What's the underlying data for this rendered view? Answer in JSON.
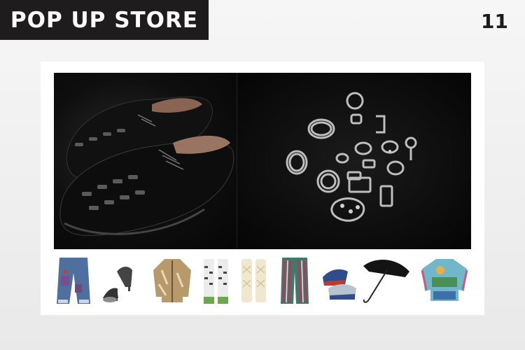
{
  "header": {
    "title": "POP UP STORE",
    "page_number": "11"
  },
  "hero_photos": [
    {
      "name": "black-woven-shoes-photo"
    },
    {
      "name": "silver-jewelry-flatlay-photo"
    }
  ],
  "products": [
    {
      "name": "patched-jeans"
    },
    {
      "name": "strappy-heels"
    },
    {
      "name": "knit-cardigan"
    },
    {
      "name": "printed-socks"
    },
    {
      "name": "lace-socks"
    },
    {
      "name": "striped-pants"
    },
    {
      "name": "two-tone-shoes"
    },
    {
      "name": "black-umbrella"
    },
    {
      "name": "printed-top"
    }
  ],
  "colors": {
    "header_bg": "#1e1c1c",
    "header_text": "#ffffff",
    "page_bg": "#efefef",
    "card_bg": "#ffffff"
  }
}
